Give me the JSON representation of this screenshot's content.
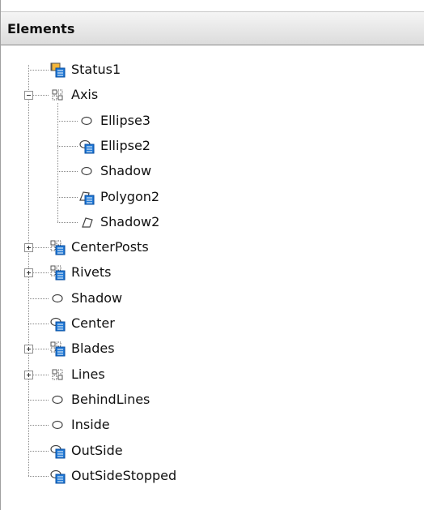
{
  "panel": {
    "title": "Elements"
  },
  "tree": {
    "items": [
      {
        "label": "Status1",
        "icon": "group-shape-icon",
        "depth": 0,
        "expander": "none"
      },
      {
        "label": "Axis",
        "icon": "group-outline-icon",
        "depth": 0,
        "expander": "expanded"
      },
      {
        "label": "Ellipse3",
        "icon": "ellipse-icon",
        "depth": 1,
        "expander": "none"
      },
      {
        "label": "Ellipse2",
        "icon": "group-ellipse-icon",
        "depth": 1,
        "expander": "none"
      },
      {
        "label": "Shadow",
        "icon": "ellipse-icon",
        "depth": 1,
        "expander": "none"
      },
      {
        "label": "Polygon2",
        "icon": "group-polygon-icon",
        "depth": 1,
        "expander": "none"
      },
      {
        "label": "Shadow2",
        "icon": "polygon-icon",
        "depth": 1,
        "expander": "none"
      },
      {
        "label": "CenterPosts",
        "icon": "group-blue-icon",
        "depth": 0,
        "expander": "collapsed"
      },
      {
        "label": "Rivets",
        "icon": "group-blue-icon",
        "depth": 0,
        "expander": "collapsed"
      },
      {
        "label": "Shadow",
        "icon": "ellipse-icon",
        "depth": 0,
        "expander": "none"
      },
      {
        "label": "Center",
        "icon": "group-ellipse-icon",
        "depth": 0,
        "expander": "none"
      },
      {
        "label": "Blades",
        "icon": "group-blue-icon",
        "depth": 0,
        "expander": "collapsed"
      },
      {
        "label": "Lines",
        "icon": "group-outline-icon",
        "depth": 0,
        "expander": "collapsed"
      },
      {
        "label": "BehindLines",
        "icon": "ellipse-icon",
        "depth": 0,
        "expander": "none"
      },
      {
        "label": "Inside",
        "icon": "ellipse-icon",
        "depth": 0,
        "expander": "none"
      },
      {
        "label": "OutSide",
        "icon": "group-ellipse-icon",
        "depth": 0,
        "expander": "none"
      },
      {
        "label": "OutSideStopped",
        "icon": "group-ellipse-icon",
        "depth": 0,
        "expander": "none"
      }
    ]
  }
}
